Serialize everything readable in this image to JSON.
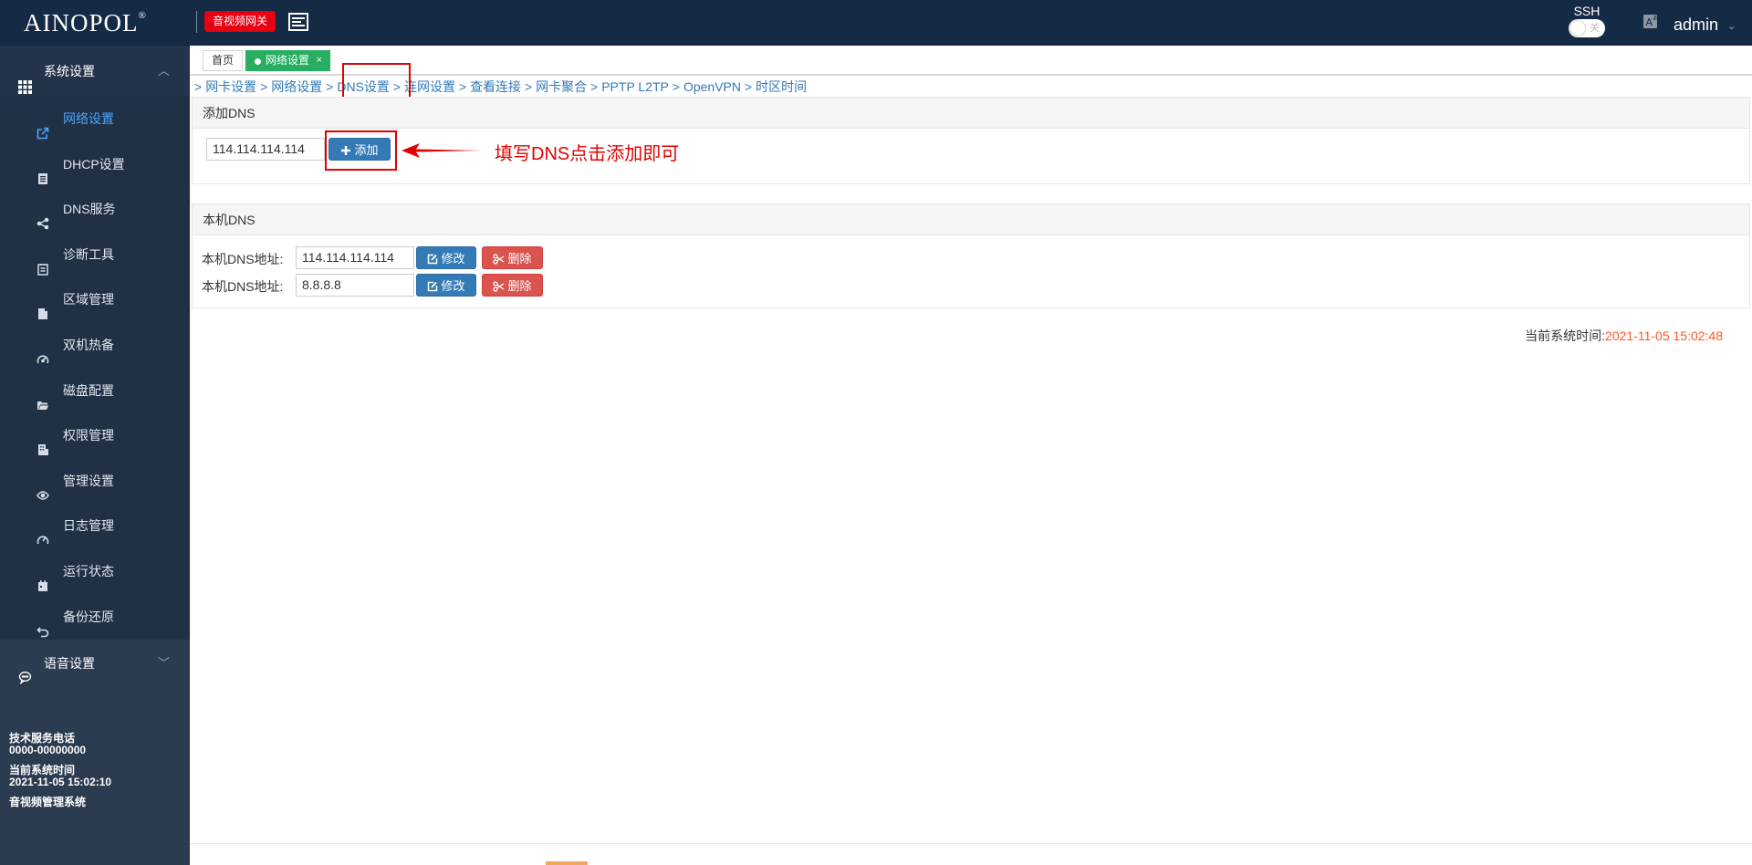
{
  "header": {
    "logo": "AINOPOL",
    "logo_mark": "®",
    "product_badge": "音视频网关",
    "ssh_label": "SSH",
    "ssh_state": "关",
    "user": "admin"
  },
  "sidebar": {
    "groups": [
      {
        "label": "系统设置",
        "icon": "grid-icon",
        "expanded": true
      },
      {
        "label": "语音设置",
        "icon": "chat-icon",
        "expanded": false
      }
    ],
    "items": [
      {
        "label": "网络设置",
        "icon": "external-link-icon",
        "active": true
      },
      {
        "label": "DHCP设置",
        "icon": "document-icon"
      },
      {
        "label": "DNS服务",
        "icon": "share-icon"
      },
      {
        "label": "诊断工具",
        "icon": "clipboard-icon"
      },
      {
        "label": "区域管理",
        "icon": "file-icon"
      },
      {
        "label": "双机热备",
        "icon": "dashboard-icon"
      },
      {
        "label": "磁盘配置",
        "icon": "folder-open-icon"
      },
      {
        "label": "权限管理",
        "icon": "building-icon"
      },
      {
        "label": "管理设置",
        "icon": "eye-icon"
      },
      {
        "label": "日志管理",
        "icon": "gauge-icon"
      },
      {
        "label": "运行状态",
        "icon": "calendar-icon"
      },
      {
        "label": "备份还原",
        "icon": "undo-icon"
      }
    ],
    "info": {
      "phone_label": "技术服务电话",
      "phone": "0000-00000000",
      "time_label": "当前系统时间",
      "time": "2021-11-05 15:02:10",
      "system_name": "音视频管理系统"
    }
  },
  "tabs": {
    "home": "首页",
    "current": "网络设置",
    "close": "×"
  },
  "breadcrumb": [
    "网卡设置",
    "网络设置",
    "DNS设置",
    "连网设置",
    "查看连接",
    "网卡聚合",
    "PPTP L2TP",
    "OpenVPN",
    "时区时间"
  ],
  "add_dns": {
    "title": "添加DNS",
    "input_value": "114.114.114.114",
    "add_button": "添加",
    "annotation": "填写DNS点击添加即可"
  },
  "local_dns": {
    "title": "本机DNS",
    "rows": [
      {
        "label": "本机DNS地址:",
        "value": "114.114.114.114"
      },
      {
        "label": "本机DNS地址:",
        "value": "8.8.8.8"
      }
    ],
    "edit_button": "修改",
    "delete_button": "删除"
  },
  "footer": {
    "time_label": "当前系统时间:",
    "time_value": "2021-11-05 15:02:48"
  },
  "colors": {
    "topbar": "#152a44",
    "sidebar": "#2b3b50",
    "accent_blue": "#337ab7",
    "accent_green": "#27ae60",
    "danger_red": "#d9534f",
    "annotation_red": "#e30000",
    "time_orange": "#ff5722"
  }
}
